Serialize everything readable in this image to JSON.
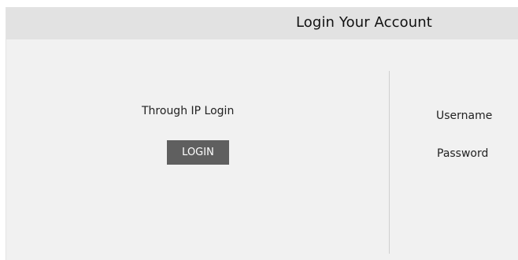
{
  "header": {
    "title": "Login Your Account"
  },
  "ip_login": {
    "label": "Through IP Login",
    "button_label": "LOGIN"
  },
  "account_login": {
    "username_label": "Username",
    "password_label": "Password"
  }
}
